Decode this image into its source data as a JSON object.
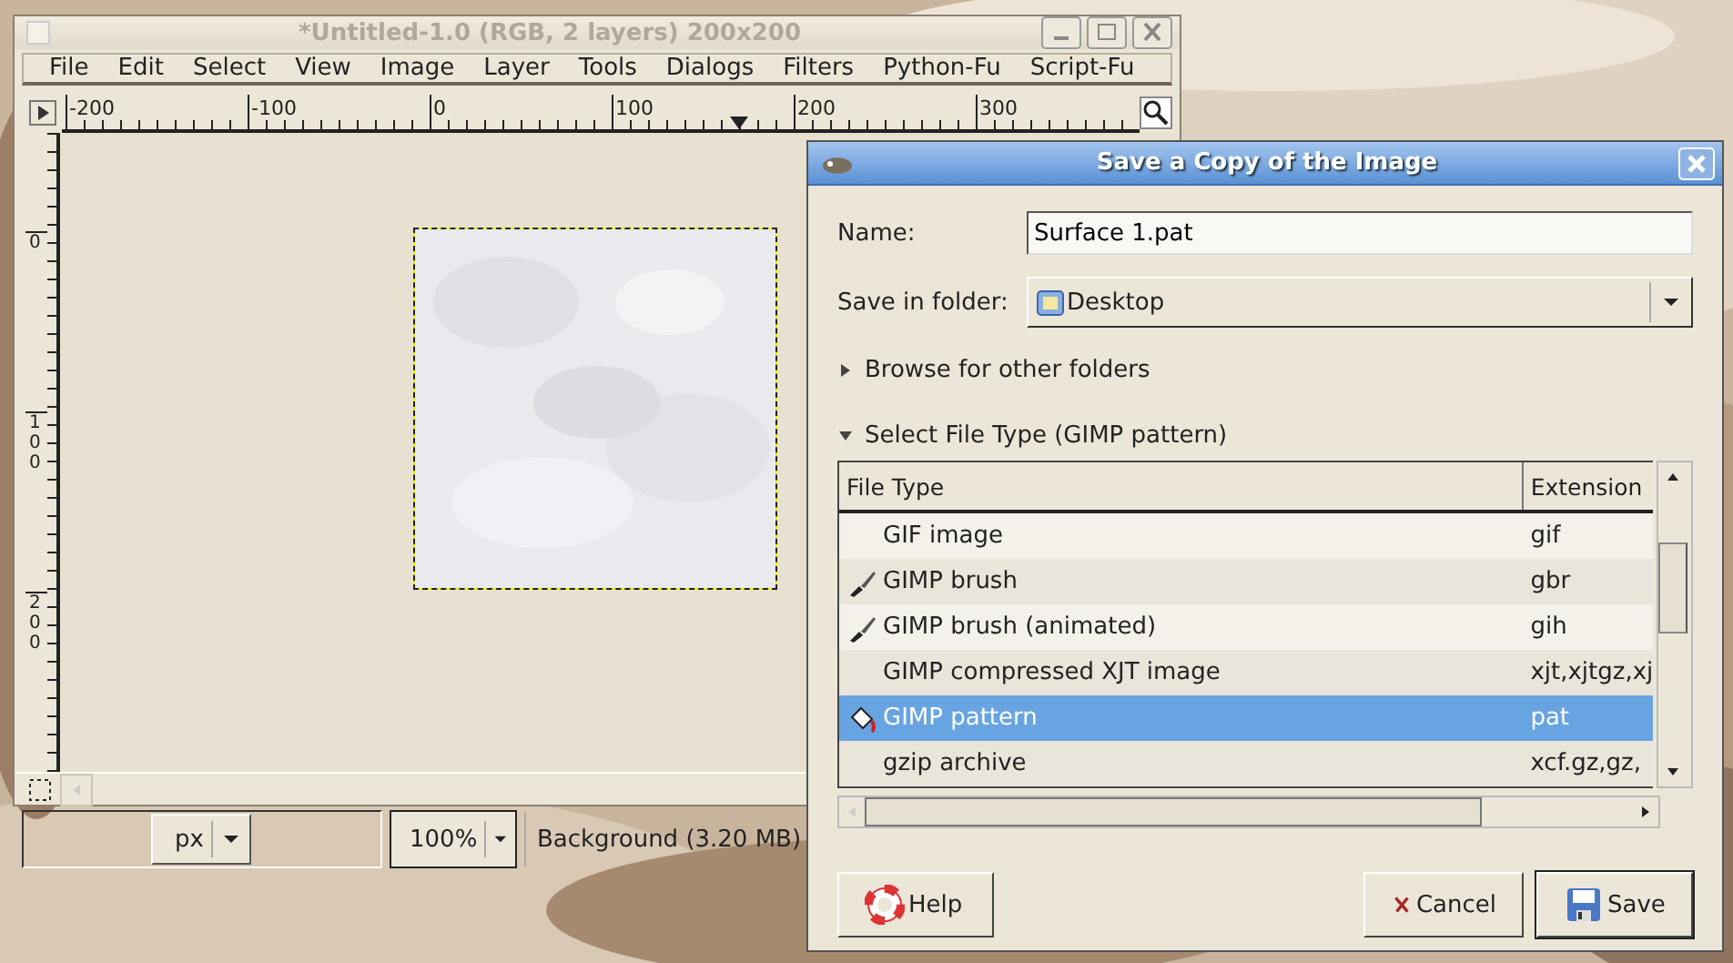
{
  "image_window": {
    "title": "*Untitled-1.0 (RGB, 2 layers) 200x200",
    "menu": [
      "File",
      "Edit",
      "Select",
      "View",
      "Image",
      "Layer",
      "Tools",
      "Dialogs",
      "Filters",
      "Python-Fu",
      "Script-Fu"
    ],
    "horizontal_ruler": [
      "-200",
      "-100",
      "0",
      "100",
      "200",
      "300"
    ],
    "vertical_ruler": [
      "0",
      "100",
      "200"
    ],
    "status": {
      "unit": "px",
      "zoom": "100%",
      "message": "Background (3.20 MB)"
    }
  },
  "dialog": {
    "title": "Save a Copy of the Image",
    "name_label": "Name:",
    "name_value": "Surface 1.pat",
    "folder_label": "Save in folder:",
    "folder": "Desktop",
    "browse": {
      "label": "Browse for other folders",
      "expanded": false
    },
    "file_type": {
      "label": "Select File Type (GIMP pattern)",
      "expanded": true
    },
    "columns": [
      "File Type",
      "Extension"
    ],
    "rows": [
      {
        "name": "GIF image",
        "extensions": "gif",
        "kind": "plain",
        "selected": false
      },
      {
        "name": "GIMP brush",
        "extensions": "gbr",
        "kind": "brush",
        "selected": false
      },
      {
        "name": "GIMP brush (animated)",
        "extensions": "gih",
        "kind": "brush",
        "selected": false
      },
      {
        "name": "GIMP compressed XJT image",
        "extensions": "xjt,xjtgz,xj",
        "kind": "plain",
        "selected": false
      },
      {
        "name": "GIMP pattern",
        "extensions": "pat",
        "kind": "pattern",
        "selected": true
      },
      {
        "name": "gzip archive",
        "extensions": "xcf.gz,gz,",
        "kind": "plain",
        "selected": false
      }
    ],
    "buttons": [
      {
        "label": "Help",
        "kind": "help"
      },
      {
        "label": "Cancel",
        "kind": "cancel"
      },
      {
        "label": "Save",
        "kind": "save"
      }
    ]
  }
}
